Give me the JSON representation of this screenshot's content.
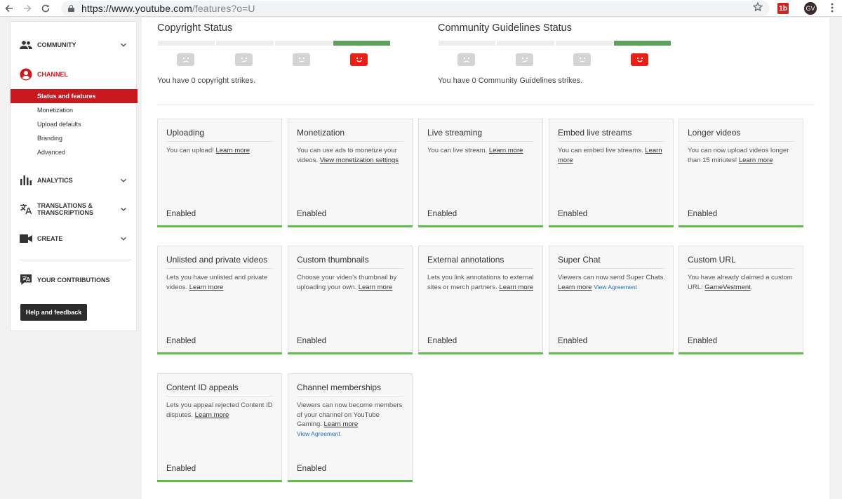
{
  "browser": {
    "url_main": "https://www.youtube.com",
    "url_path": "/features?o=U",
    "ext1_label": "1b",
    "ext2_label": "GV"
  },
  "sidebar": {
    "community": "COMMUNITY",
    "channel": "CHANNEL",
    "channel_items": [
      "Status and features",
      "Monetization",
      "Upload defaults",
      "Branding",
      "Advanced"
    ],
    "analytics": "ANALYTICS",
    "translations_line1": "TRANSLATIONS &",
    "translations_line2": "TRANSCRIPTIONS",
    "create": "CREATE",
    "contributions": "YOUR CONTRIBUTIONS",
    "help_button": "Help and feedback"
  },
  "status": {
    "copyright_title": "Copyright Status",
    "copyright_text": "You have 0 copyright strikes.",
    "guidelines_title": "Community Guidelines Status",
    "guidelines_text": "You have 0 Community Guidelines strikes."
  },
  "cards": [
    {
      "title": "Uploading",
      "desc": "You can upload!",
      "link": "Learn more",
      "extra": "",
      "status": "Enabled"
    },
    {
      "title": "Monetization",
      "desc": "You can use ads to monetize your videos.",
      "link": "View monetization settings",
      "extra": "",
      "status": "Enabled"
    },
    {
      "title": "Live streaming",
      "desc": "You can live stream.",
      "link": "Learn more",
      "extra": "",
      "status": "Enabled"
    },
    {
      "title": "Embed live streams",
      "desc": "You can embed live streams.",
      "link": "Learn more",
      "extra": "",
      "status": "Enabled"
    },
    {
      "title": "Longer videos",
      "desc": "You can now upload videos longer than 15 minutes!",
      "link": "Learn more",
      "extra": "",
      "status": "Enabled"
    },
    {
      "title": "Unlisted and private videos",
      "desc": "Lets you have unlisted and private videos.",
      "link": "Learn more",
      "extra": "",
      "status": "Enabled"
    },
    {
      "title": "Custom thumbnails",
      "desc": "Choose your video's thumbnail by uploading your own.",
      "link": "Learn more",
      "extra": "",
      "status": "Enabled"
    },
    {
      "title": "External annotations",
      "desc": "Lets you link annotations to external sites or merch partners.",
      "link": "Learn more",
      "extra": "",
      "status": "Enabled"
    },
    {
      "title": "Super Chat",
      "desc": "Viewers can now send Super Chats.",
      "link": "Learn more",
      "extra": "View Agreement",
      "status": "Enabled"
    },
    {
      "title": "Custom URL",
      "desc": "You have already claimed a custom URL:",
      "link": "GameVestment",
      "extra": "",
      "status": "Enabled"
    },
    {
      "title": "Content ID appeals",
      "desc": "Lets you appeal rejected Content ID disputes.",
      "link": "Learn more",
      "extra": "",
      "status": "Enabled"
    },
    {
      "title": "Channel memberships",
      "desc": "Viewers can now become members of your channel on YouTube Gaming.",
      "link": "Learn more",
      "extra": "View Agreement",
      "status": "Enabled"
    }
  ],
  "colors": {
    "brand_red": "#cc181e",
    "enabled_green": "#5ebf4b",
    "status_green": "#5aa55a",
    "link_blue": "#2a6fbb"
  }
}
